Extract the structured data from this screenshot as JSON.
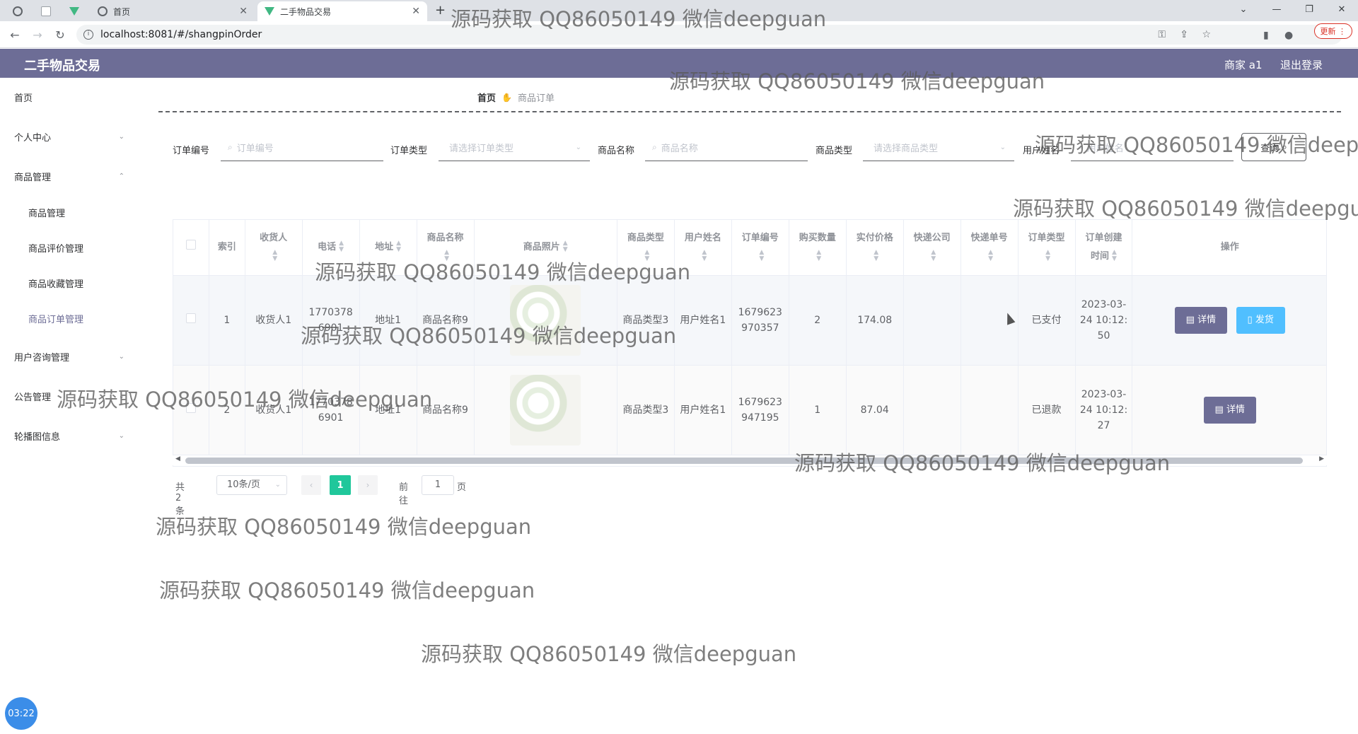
{
  "browser": {
    "tabs": [
      {
        "title": ""
      },
      {
        "title": ""
      },
      {
        "title": ""
      },
      {
        "title": "首页"
      },
      {
        "title": "二手物品交易"
      }
    ],
    "url": "localhost:8081/#/shangpinOrder",
    "update_label": "更新",
    "new_tab": "+"
  },
  "header": {
    "title": "二手物品交易",
    "user": "商家 a1",
    "logout": "退出登录"
  },
  "sidebar": {
    "items": [
      {
        "label": "首页"
      },
      {
        "label": "个人中心"
      },
      {
        "label": "商品管理"
      },
      {
        "label": "商品管理"
      },
      {
        "label": "商品评价管理"
      },
      {
        "label": "商品收藏管理"
      },
      {
        "label": "商品订单管理"
      },
      {
        "label": "用户咨询管理"
      },
      {
        "label": "公告管理"
      },
      {
        "label": "轮播图信息"
      }
    ]
  },
  "breadcrumb": {
    "home": "首页",
    "current": "商品订单"
  },
  "search": {
    "order_no_label": "订单编号",
    "order_no_placeholder": "订单编号",
    "order_type_label": "订单类型",
    "order_type_placeholder": "请选择订单类型",
    "goods_name_label": "商品名称",
    "goods_name_placeholder": "商品名称",
    "goods_type_label": "商品类型",
    "goods_type_placeholder": "请选择商品类型",
    "user_name_label": "用户姓名",
    "user_name_placeholder": "用户姓名",
    "query_label": "查询"
  },
  "table": {
    "headers": {
      "index": "索引",
      "receiver": "收货人",
      "phone": "电话",
      "address": "地址",
      "goods_name": "商品名称",
      "goods_photo": "商品照片",
      "goods_type": "商品类型",
      "user_name": "用户姓名",
      "order_no": "订单编号",
      "quantity": "购买数量",
      "price": "实付价格",
      "express_company": "快递公司",
      "express_no": "快递单号",
      "order_type": "订单类型",
      "order_created_line1": "订单创建",
      "order_created_line2": "时间",
      "actions": "操作"
    },
    "rows": [
      {
        "index": "1",
        "receiver": "收货人1",
        "phone": "17703786901",
        "address": "地址1",
        "goods_name": "商品名称9",
        "goods_type": "商品类型3",
        "user_name": "用户姓名1",
        "order_no": "1679623970357",
        "quantity": "2",
        "price": "174.08",
        "express_company": "",
        "express_no": "",
        "order_type": "已支付",
        "created": "2023-03-24 10:12:50",
        "detail_label": "详情",
        "ship_label": "发货"
      },
      {
        "index": "2",
        "receiver": "收货人1",
        "phone": "17703786901",
        "address": "地址1",
        "goods_name": "商品名称9",
        "goods_type": "商品类型3",
        "user_name": "用户姓名1",
        "order_no": "1679623947195",
        "quantity": "1",
        "price": "87.04",
        "express_company": "",
        "express_no": "",
        "order_type": "已退款",
        "created": "2023-03-24 10:12:27",
        "detail_label": "详情"
      }
    ]
  },
  "pagination": {
    "total": "共 2 条",
    "page_size": "10条/页",
    "current_page": "1",
    "goto_label": "前往",
    "goto_value": "1",
    "page_label": "页"
  },
  "watermark": "源码获取 QQ86050149 微信deepguan",
  "clock": "03:22"
}
